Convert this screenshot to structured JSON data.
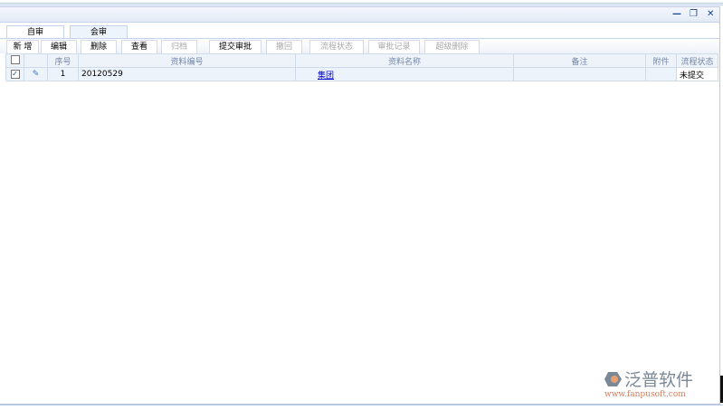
{
  "window": {
    "minimize": "—",
    "restore": "❐",
    "close": "✕"
  },
  "tabs": [
    {
      "label": "自审",
      "active": true
    },
    {
      "label": "会审",
      "active": false
    }
  ],
  "toolbar": [
    {
      "label": "新 增",
      "enabled": true
    },
    {
      "label": "编辑",
      "enabled": true
    },
    {
      "label": "删除",
      "enabled": true
    },
    {
      "label": "查看",
      "enabled": true
    },
    {
      "label": "归档",
      "enabled": false
    },
    {
      "label": "提交审批",
      "enabled": true
    },
    {
      "label": "撤回",
      "enabled": false
    },
    {
      "label": "流程状态",
      "enabled": false
    },
    {
      "label": "审批记录",
      "enabled": false
    },
    {
      "label": "超级删除",
      "enabled": false
    }
  ],
  "table": {
    "headers": [
      "",
      "",
      "序号",
      "资料编号",
      "资料名称",
      "备注",
      "附件",
      "流程状态"
    ],
    "rows": [
      {
        "checked": true,
        "index": "1",
        "code": "20120529",
        "name": "集团",
        "note": "",
        "attachment": "",
        "status": "未提交"
      }
    ]
  },
  "logo": {
    "name": "泛普软件",
    "url": "www.fanpusoft.com"
  },
  "colors": {
    "accent": "#15428b",
    "header_bg": "#eef3fa",
    "row_bg": "#edf3fb"
  }
}
